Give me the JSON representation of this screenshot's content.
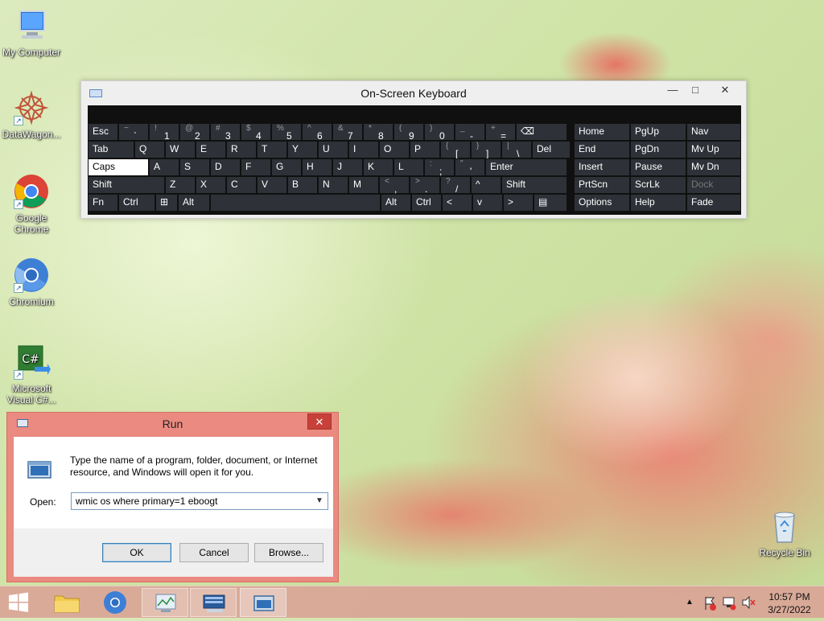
{
  "desktop": {
    "icons": [
      {
        "label": "My Computer"
      },
      {
        "label": "DataWagon..."
      },
      {
        "label": "Google Chrome"
      },
      {
        "label": "Chromium"
      },
      {
        "label": "Microsoft Visual C#..."
      },
      {
        "label": "Recycle Bin"
      }
    ]
  },
  "osk": {
    "title": "On-Screen Keyboard",
    "rows": {
      "r1": [
        {
          "label": "Esc"
        },
        {
          "shift": "~",
          "main": "`"
        },
        {
          "shift": "!",
          "main": "1"
        },
        {
          "shift": "@",
          "main": "2"
        },
        {
          "shift": "#",
          "main": "3"
        },
        {
          "shift": "$",
          "main": "4"
        },
        {
          "shift": "%",
          "main": "5"
        },
        {
          "shift": "^",
          "main": "6"
        },
        {
          "shift": "&",
          "main": "7"
        },
        {
          "shift": "*",
          "main": "8"
        },
        {
          "shift": "(",
          "main": "9"
        },
        {
          "shift": ")",
          "main": "0"
        },
        {
          "shift": "_",
          "main": "-"
        },
        {
          "shift": "+",
          "main": "="
        },
        {
          "label": "⌫"
        },
        {
          "label": "Home"
        },
        {
          "label": "PgUp"
        },
        {
          "label": "Nav"
        }
      ],
      "r2": [
        {
          "label": "Tab"
        },
        {
          "label": "Q"
        },
        {
          "label": "W"
        },
        {
          "label": "E"
        },
        {
          "label": "R"
        },
        {
          "label": "T"
        },
        {
          "label": "Y"
        },
        {
          "label": "U"
        },
        {
          "label": "I"
        },
        {
          "label": "O"
        },
        {
          "label": "P"
        },
        {
          "shift": "{",
          "main": "["
        },
        {
          "shift": "}",
          "main": "]"
        },
        {
          "shift": "|",
          "main": "\\"
        },
        {
          "label": "Del"
        },
        {
          "label": "End"
        },
        {
          "label": "PgDn"
        },
        {
          "label": "Mv Up"
        }
      ],
      "r3": [
        {
          "label": "Caps"
        },
        {
          "label": "A"
        },
        {
          "label": "S"
        },
        {
          "label": "D"
        },
        {
          "label": "F"
        },
        {
          "label": "G"
        },
        {
          "label": "H"
        },
        {
          "label": "J"
        },
        {
          "label": "K"
        },
        {
          "label": "L"
        },
        {
          "shift": ":",
          "main": ";"
        },
        {
          "shift": "\"",
          "main": "'"
        },
        {
          "label": "Enter"
        },
        {
          "label": "Insert"
        },
        {
          "label": "Pause"
        },
        {
          "label": "Mv Dn"
        }
      ],
      "r4": [
        {
          "label": "Shift"
        },
        {
          "label": "Z"
        },
        {
          "label": "X"
        },
        {
          "label": "C"
        },
        {
          "label": "V"
        },
        {
          "label": "B"
        },
        {
          "label": "N"
        },
        {
          "label": "M"
        },
        {
          "shift": "<",
          "main": ","
        },
        {
          "shift": ">",
          "main": "."
        },
        {
          "shift": "?",
          "main": "/"
        },
        {
          "label": "^"
        },
        {
          "label": "Shift"
        },
        {
          "label": "PrtScn"
        },
        {
          "label": "ScrLk"
        },
        {
          "label": "Dock"
        }
      ],
      "r5": [
        {
          "label": "Fn"
        },
        {
          "label": "Ctrl"
        },
        {
          "label": "⊞"
        },
        {
          "label": "Alt"
        },
        {
          "label": ""
        },
        {
          "label": "Alt"
        },
        {
          "label": "Ctrl"
        },
        {
          "label": "<"
        },
        {
          "label": "v"
        },
        {
          "label": ">"
        },
        {
          "label": "▤"
        },
        {
          "label": "Options"
        },
        {
          "label": "Help"
        },
        {
          "label": "Fade"
        }
      ]
    }
  },
  "run": {
    "title": "Run",
    "description": "Type the name of a program, folder, document, or Internet resource, and Windows will open it for you.",
    "open_label": "Open:",
    "open_value": "wmic os where primary=1 eboogt",
    "ok_label": "OK",
    "cancel_label": "Cancel",
    "browse_label": "Browse..."
  },
  "taskbar": {
    "time": "10:57 PM",
    "date": "3/27/2022"
  },
  "colors": {
    "accent_pink": "#ea8a80",
    "close_red": "#c7413a",
    "key_dark": "#2e3238"
  }
}
